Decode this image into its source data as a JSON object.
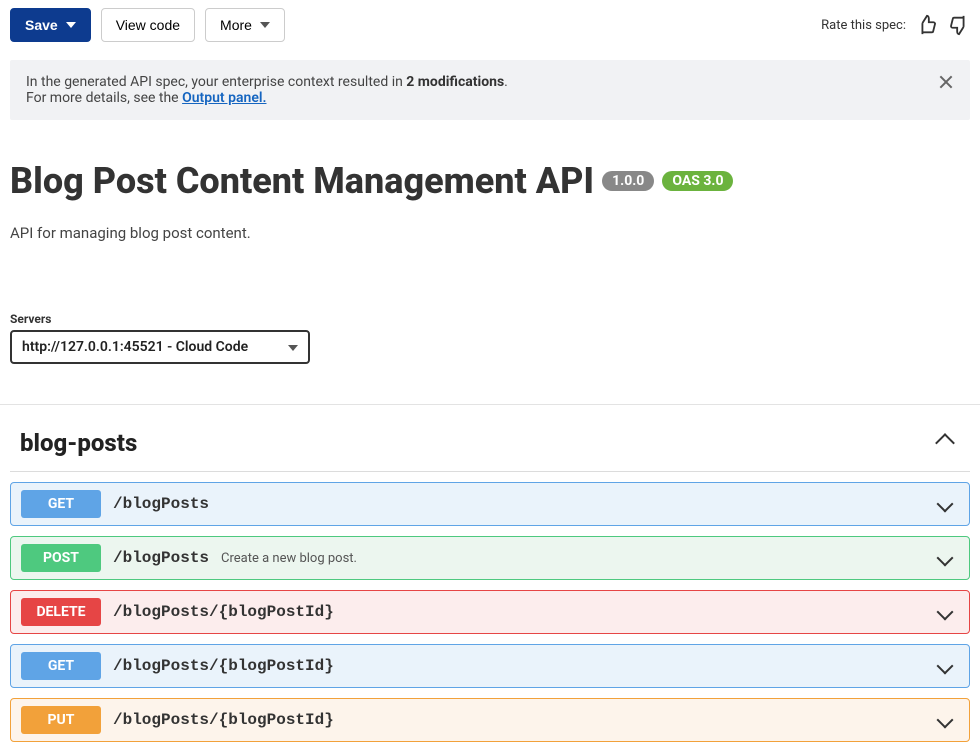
{
  "toolbar": {
    "save_label": "Save",
    "view_code_label": "View code",
    "more_label": "More",
    "rate_label": "Rate this spec:"
  },
  "notice": {
    "line1_prefix": "In the generated API spec, your enterprise context resulted in ",
    "line1_bold": "2 modifications",
    "line1_suffix": ".",
    "line2_prefix": "For more details, see the ",
    "link_text": "Output panel."
  },
  "api": {
    "title": "Blog Post Content Management API",
    "version": "1.0.0",
    "oas_badge": "OAS 3.0",
    "description": "API for managing blog post content."
  },
  "servers": {
    "label": "Servers",
    "selected": "http://127.0.0.1:45521 - Cloud Code"
  },
  "tag": {
    "name": "blog-posts"
  },
  "ops": [
    {
      "method": "GET",
      "css": "op-get",
      "path": "/blogPosts",
      "summary": ""
    },
    {
      "method": "POST",
      "css": "op-post",
      "path": "/blogPosts",
      "summary": "Create a new blog post."
    },
    {
      "method": "DELETE",
      "css": "op-delete",
      "path": "/blogPosts/{blogPostId}",
      "summary": ""
    },
    {
      "method": "GET",
      "css": "op-get",
      "path": "/blogPosts/{blogPostId}",
      "summary": ""
    },
    {
      "method": "PUT",
      "css": "op-put",
      "path": "/blogPosts/{blogPostId}",
      "summary": ""
    }
  ]
}
